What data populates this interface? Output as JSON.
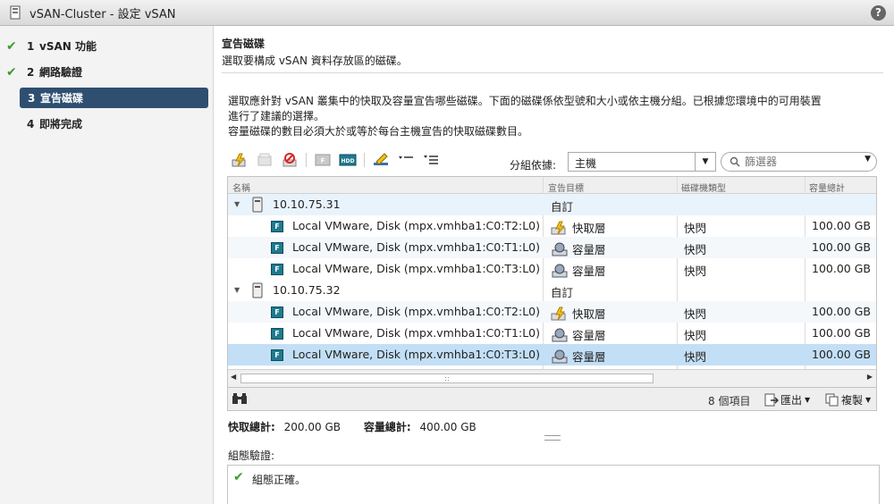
{
  "window": {
    "title": "vSAN-Cluster - 設定 vSAN",
    "help_label": "?"
  },
  "wizard": {
    "steps": [
      {
        "num": "1",
        "label": "vSAN 功能",
        "done": true
      },
      {
        "num": "2",
        "label": "網路驗證",
        "done": true
      },
      {
        "num": "3",
        "label": "宣告磁碟",
        "active": true
      },
      {
        "num": "4",
        "label": "即將完成"
      }
    ]
  },
  "page": {
    "title": "宣告磁碟",
    "subtitle": "選取要構成 vSAN 資料存放區的磁碟。",
    "desc_line1": "選取應針對 vSAN 叢集中的快取及容量宣告哪些磁碟。下面的磁碟係依型號和大小或依主機分組。已根據您環境中的可用裝置",
    "desc_line2": "進行了建議的選擇。",
    "desc_line3": "容量磁碟的數目必須大於或等於每台主機宣告的快取磁碟數目。"
  },
  "toolbar": {
    "group_by_label": "分組依據:",
    "group_by_value": "主機",
    "filter_placeholder": "篩選器",
    "icons": [
      "claim-cache-icon",
      "claim-capacity-icon",
      "do-not-claim-icon",
      "mark-flash-icon",
      "mark-hdd-icon",
      "edit-icon",
      "collapse-all-icon",
      "expand-all-icon"
    ]
  },
  "grid": {
    "columns": [
      "名稱",
      "宣告目標",
      "磁碟機類型",
      "容量總計"
    ],
    "hosts": [
      {
        "name": "10.10.75.31",
        "claim": "自訂",
        "disks": [
          {
            "name": "Local VMware, Disk (mpx.vmhba1:C0:T2:L0)",
            "claim": "快取層",
            "type": "快閃",
            "capacity": "100.00 GB"
          },
          {
            "name": "Local VMware, Disk (mpx.vmhba1:C0:T1:L0)",
            "claim": "容量層",
            "type": "快閃",
            "capacity": "100.00 GB"
          },
          {
            "name": "Local VMware, Disk (mpx.vmhba1:C0:T3:L0)",
            "claim": "容量層",
            "type": "快閃",
            "capacity": "100.00 GB"
          }
        ]
      },
      {
        "name": "10.10.75.32",
        "claim": "自訂",
        "disks": [
          {
            "name": "Local VMware, Disk (mpx.vmhba1:C0:T2:L0)",
            "claim": "快取層",
            "type": "快閃",
            "capacity": "100.00 GB"
          },
          {
            "name": "Local VMware, Disk (mpx.vmhba1:C0:T1:L0)",
            "claim": "容量層",
            "type": "快閃",
            "capacity": "100.00 GB"
          },
          {
            "name": "Local VMware, Disk (mpx.vmhba1:C0:T3:L0)",
            "claim": "容量層",
            "type": "快閃",
            "capacity": "100.00 GB"
          }
        ]
      }
    ],
    "disk_badge": "F",
    "scroll_grip": "::",
    "item_count": "8 個項目",
    "export_label": "匯出",
    "copy_label": "複製"
  },
  "totals": {
    "cache_label": "快取總計:",
    "cache_value": "200.00 GB",
    "capacity_label": "容量總計:",
    "capacity_value": "400.00 GB"
  },
  "validation": {
    "label": "組態驗證:",
    "message": "組態正確。"
  },
  "colors": {
    "accent": "#2f4f70",
    "selected_row": "#c3dff6",
    "ok": "#3e9a2e"
  }
}
